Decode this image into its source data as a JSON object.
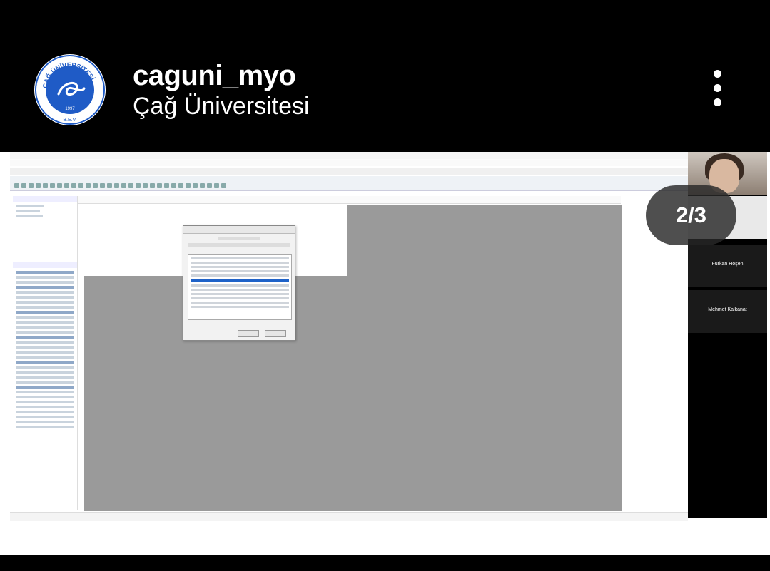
{
  "post": {
    "username": "caguni_myo",
    "fullname": "Çağ Üniversitesi",
    "logo": {
      "ring_text": "ÇAĞ ÜNİVERSİTESİ",
      "year": "1997",
      "bottom_text": "B.E.V.",
      "color": "#1f5bc6"
    },
    "menu_icon": "more-vertical-icon",
    "page_indicator": "2/3"
  },
  "video_call": {
    "tiles": [
      {
        "name": "Furkan Hoşen"
      },
      {
        "name": "Mehmet Kalkanat"
      }
    ]
  },
  "colors": {
    "background": "#000000",
    "design_area": "#9a9a9a",
    "selection": "#1e62c8"
  }
}
